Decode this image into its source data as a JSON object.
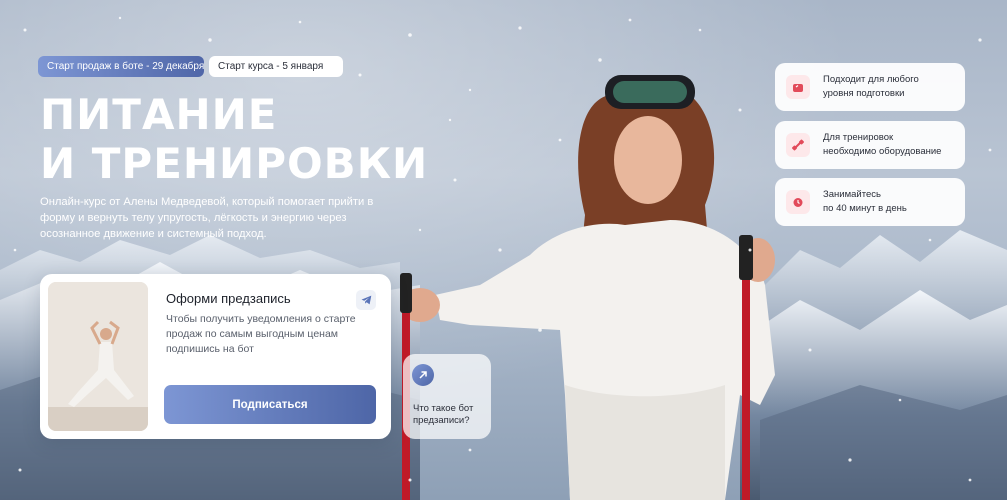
{
  "badges": {
    "sale_start": "Старт продаж в боте - 29 декабря",
    "course_start": "Старт курса - 5 января"
  },
  "hero": {
    "title_line1": "ПИТАНИЕ",
    "title_line2": "И ТРЕНИРОВКИ",
    "description": "Онлайн-курс от Алены Медведевой, который помогает прийти в форму и вернуть телу упругость, лёгкость и энергию через осознанное движение и системный подход."
  },
  "signup_card": {
    "title": "Оформи предзапись",
    "text": "Чтобы получить уведомления о старте продаж по самым выгодным ценам подпишись на бот",
    "button_label": "Подписаться",
    "telegram_icon": "telegram-icon"
  },
  "bot_info": {
    "text": "Что такое бот предзаписи?",
    "icon": "arrow-up-right-icon"
  },
  "features": [
    {
      "icon": "scale-icon",
      "line1": "Подходит для любого",
      "line2": "уровня подготовки"
    },
    {
      "icon": "dumbbell-icon",
      "line1": "Для тренировок",
      "line2": "необходимо оборудование"
    },
    {
      "icon": "alarm-clock-icon",
      "line1": "Занимайтесь",
      "line2": "по 40 минут в день"
    }
  ],
  "colors": {
    "accent_start": "#7d96d4",
    "accent_end": "#4e66a7",
    "feature_icon_bg": "#fde8ea",
    "feature_icon": "#e24a5a"
  }
}
